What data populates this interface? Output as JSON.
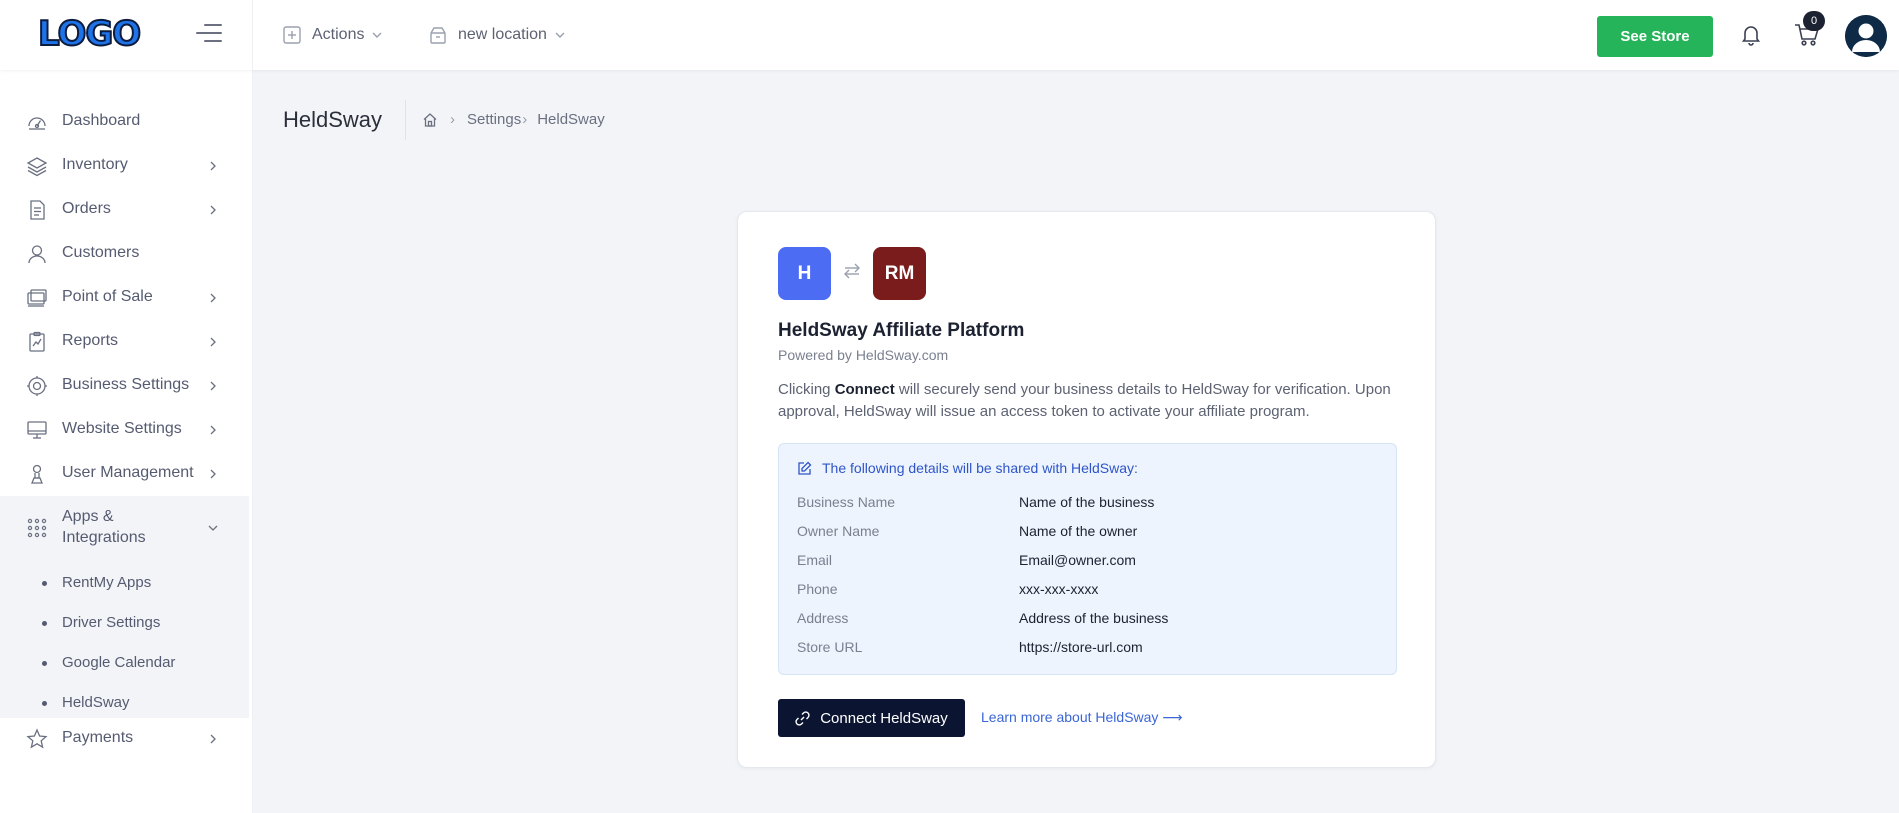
{
  "header": {
    "logo_text": "LOGO",
    "actions_label": "Actions",
    "location_label": "new location",
    "see_store_label": "See Store",
    "cart_count": "0"
  },
  "sidebar": {
    "items": [
      {
        "label": "Dashboard",
        "icon": "dashboard-icon",
        "has_chevron": false
      },
      {
        "label": "Inventory",
        "icon": "layers-icon",
        "has_chevron": true
      },
      {
        "label": "Orders",
        "icon": "document-icon",
        "has_chevron": true
      },
      {
        "label": "Customers",
        "icon": "user-icon",
        "has_chevron": false
      },
      {
        "label": "Point of Sale",
        "icon": "pos-icon",
        "has_chevron": true
      },
      {
        "label": "Reports",
        "icon": "report-icon",
        "has_chevron": true
      },
      {
        "label": "Business Settings",
        "icon": "gear-icon",
        "has_chevron": true
      },
      {
        "label": "Website Settings",
        "icon": "monitor-icon",
        "has_chevron": true
      },
      {
        "label": "User Management",
        "icon": "user-manage-icon",
        "has_chevron": true
      },
      {
        "label": "Apps & Integrations",
        "icon": "apps-grid-icon",
        "has_chevron": true,
        "expanded": true
      },
      {
        "label": "Payments",
        "icon": "star-icon",
        "has_chevron": true
      }
    ],
    "apps_subitems": [
      {
        "label": "RentMy Apps"
      },
      {
        "label": "Driver Settings"
      },
      {
        "label": "Google Calendar"
      },
      {
        "label": "HeldSway",
        "active": true
      }
    ]
  },
  "page": {
    "title": "HeldSway",
    "breadcrumb": [
      "Settings",
      "HeldSway"
    ]
  },
  "card": {
    "logo_left": "H",
    "logo_right": "RM",
    "title": "HeldSway Affiliate Platform",
    "subtitle": "Powered by HeldSway.com",
    "desc_pre": "Clicking ",
    "desc_bold": "Connect",
    "desc_post": " will securely send your business details to HeldSway for verification. Upon approval, HeldSway will issue an access token to activate your affiliate program.",
    "details_heading": "The following details will be shared with HeldSway:",
    "details": [
      {
        "key": "Business Name",
        "value": "Name of the business"
      },
      {
        "key": "Owner Name",
        "value": "Name of the owner"
      },
      {
        "key": "Email",
        "value": "Email@owner.com"
      },
      {
        "key": "Phone",
        "value": "xxx-xxx-xxxx"
      },
      {
        "key": "Address",
        "value": "Address of the business"
      },
      {
        "key": "Store URL",
        "value": "https://store-url.com"
      }
    ],
    "connect_label": "Connect HeldSway",
    "learn_more_label": "Learn more about HeldSway ⟶"
  },
  "colors": {
    "accent_green": "#26b45a",
    "brand_blue": "#4d6cf4",
    "brand_maroon": "#7a1c1c",
    "dark_navy": "#0b1532",
    "link_blue": "#3a66d6"
  }
}
